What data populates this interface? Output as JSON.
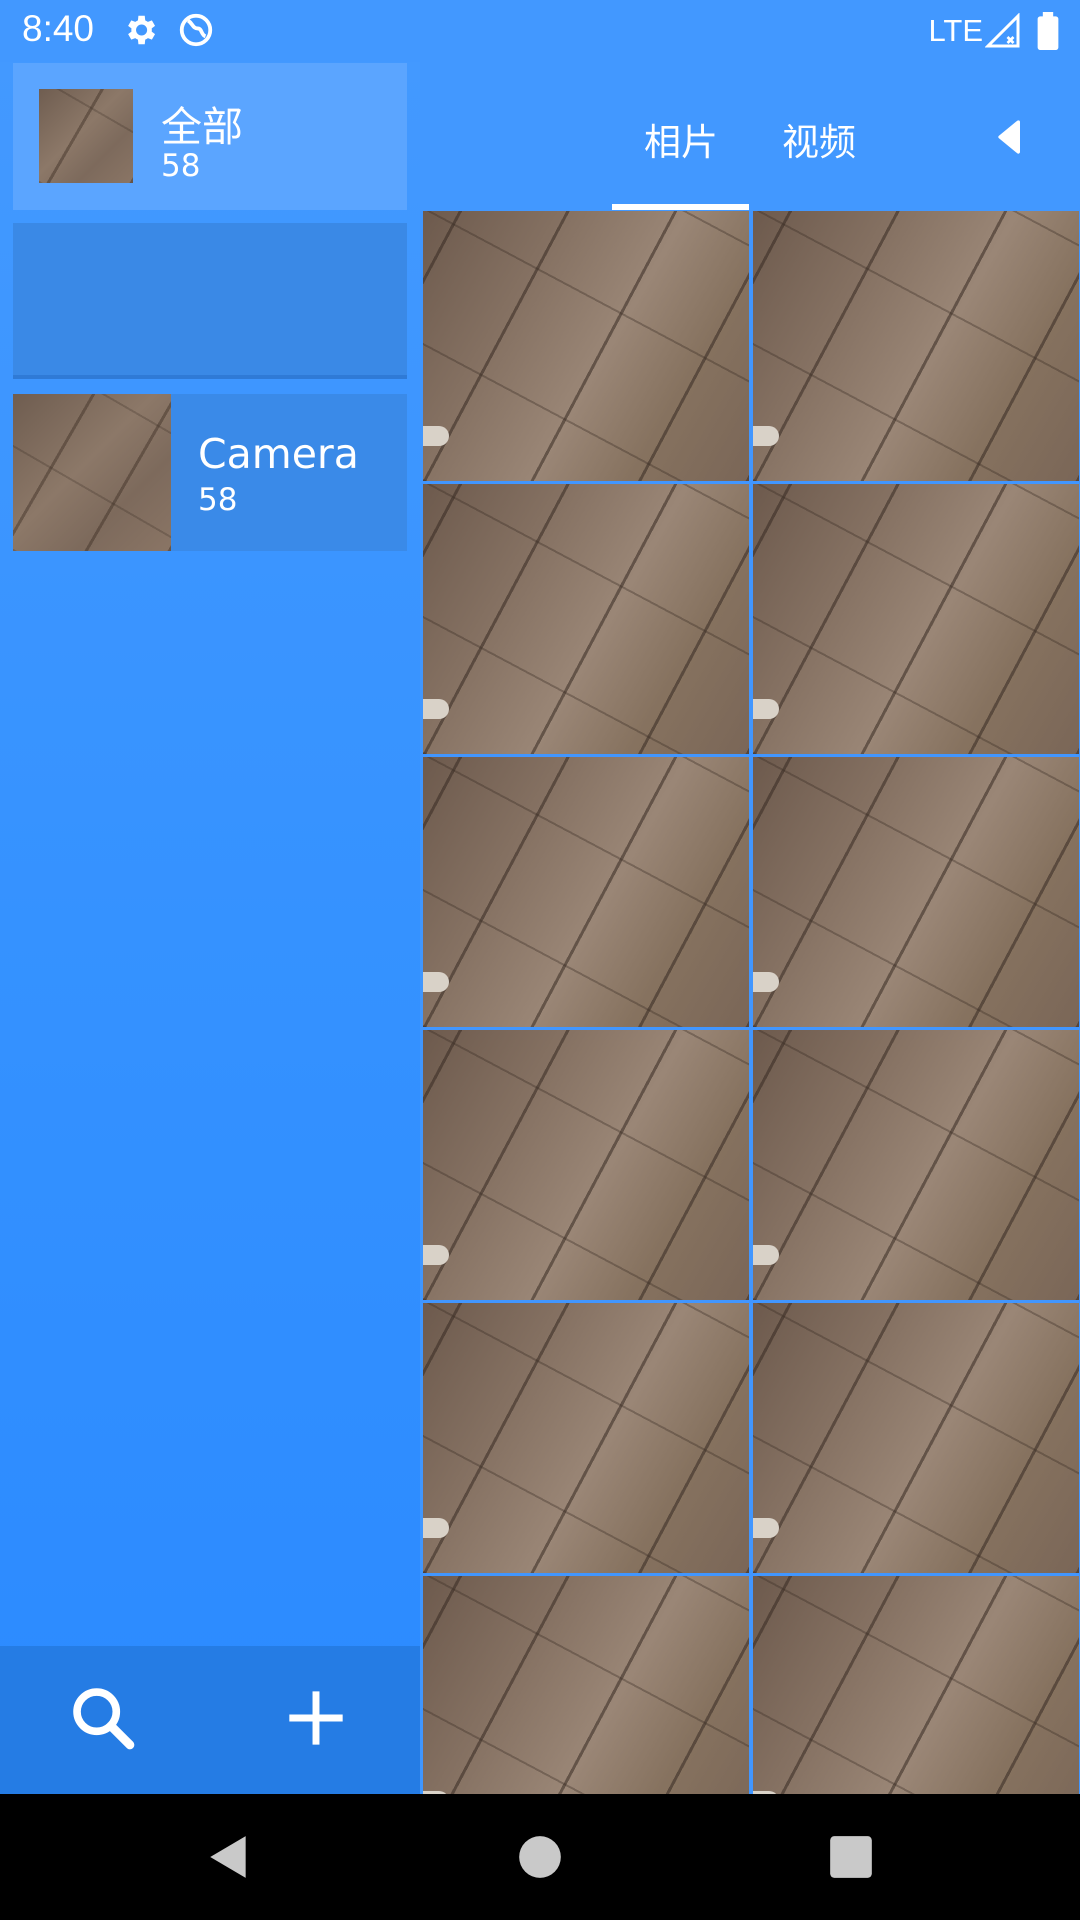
{
  "status_bar": {
    "time": "8:40",
    "icons": [
      "settings-icon",
      "vpn-globe-icon"
    ],
    "network": "LTE",
    "right_icons": [
      "signal-icon",
      "battery-icon"
    ]
  },
  "sidebar": {
    "albums": [
      {
        "title": "全部",
        "count": "58",
        "selected": true
      },
      {
        "title": "",
        "count": "",
        "selected": false
      },
      {
        "title": "Camera",
        "count": "58",
        "selected": false
      }
    ],
    "bottom_actions": [
      "search-icon",
      "add-icon"
    ]
  },
  "header": {
    "tabs": [
      {
        "label": "相片",
        "active": true
      },
      {
        "label": "视频",
        "active": false
      }
    ],
    "back_icon": "caret-left-icon"
  },
  "grid": {
    "columns": 2,
    "photo_count_visible": 12
  },
  "nav_bar": {
    "buttons": [
      "back-triangle-icon",
      "home-circle-icon",
      "recents-square-icon"
    ]
  },
  "colors": {
    "primary": "#4298ff",
    "sidebar_selected": "#5ba5ff",
    "bottom_bar": "#257ce4"
  }
}
